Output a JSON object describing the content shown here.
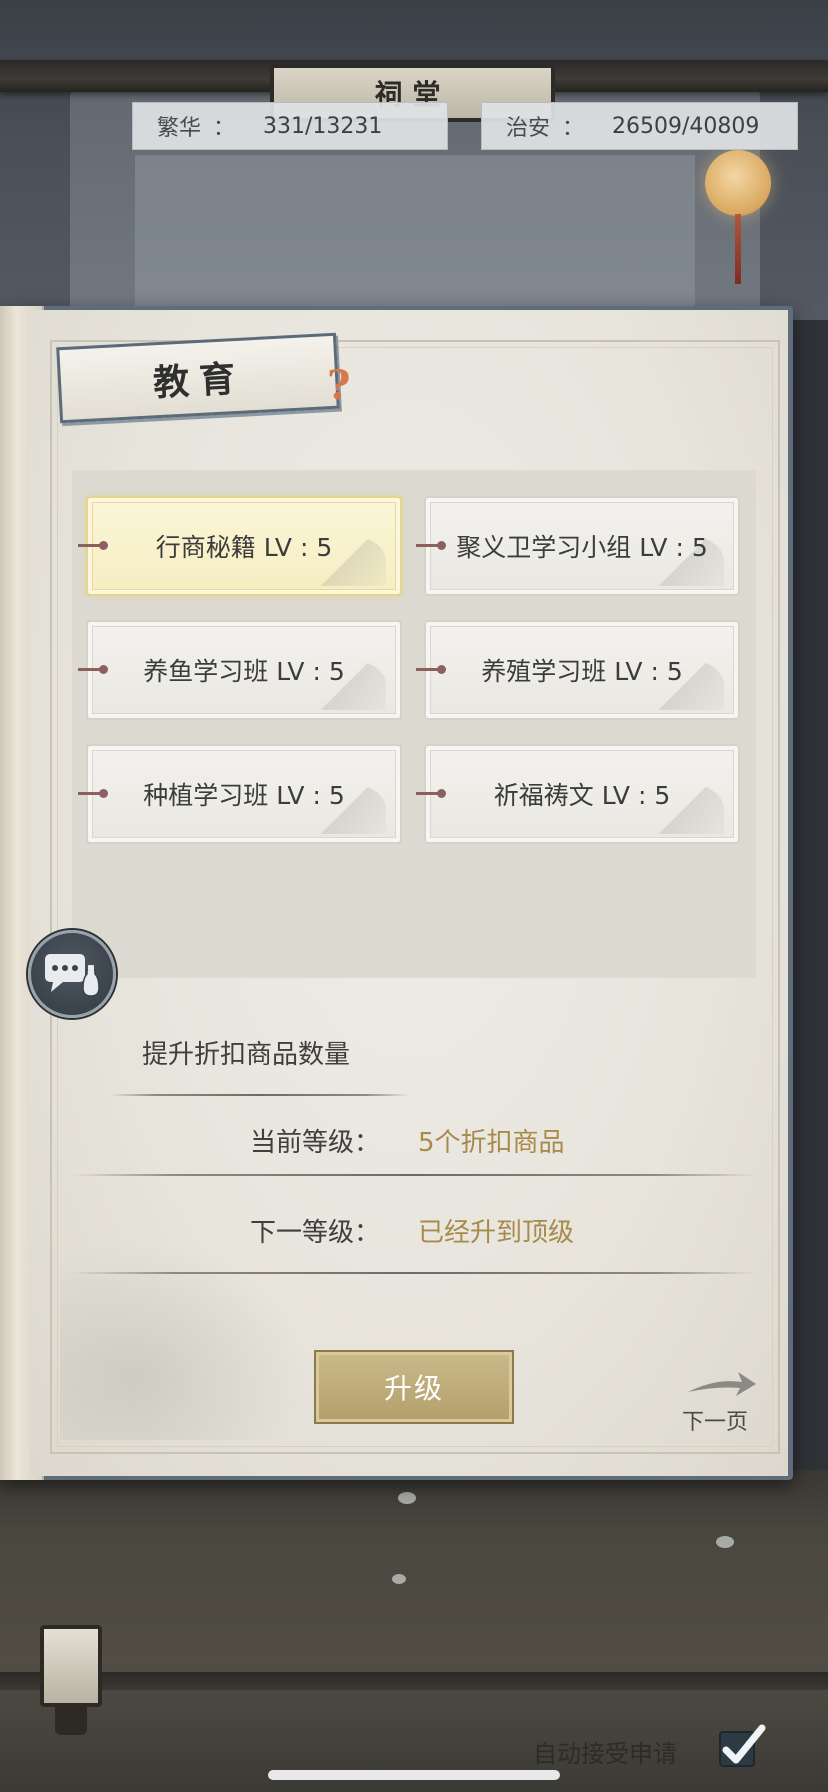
{
  "hall_sign": "祠堂",
  "stats": {
    "prosperity": {
      "label": "繁华",
      "colon": "：",
      "value": "331/13231"
    },
    "security": {
      "label": "治安",
      "colon": "：",
      "value": "26509/40809"
    }
  },
  "panel": {
    "title": "教育",
    "help_symbol": "?"
  },
  "courses": [
    {
      "label": "行商秘籍 LV : 5",
      "selected": true
    },
    {
      "label": "聚义卫学习小组 LV : 5",
      "selected": false
    },
    {
      "label": "养鱼学习班 LV : 5",
      "selected": false
    },
    {
      "label": "养殖学习班 LV : 5",
      "selected": false
    },
    {
      "label": "种植学习班 LV : 5",
      "selected": false
    },
    {
      "label": "祈福祷文 LV : 5",
      "selected": false
    }
  ],
  "detail": {
    "description": "提升折扣商品数量",
    "current_label": "当前等级：",
    "current_value": "5个折扣商品",
    "next_label": "下一等级：",
    "next_value": "已经升到顶级"
  },
  "buttons": {
    "upgrade": "升级",
    "next_page": "下一页"
  },
  "footer": {
    "auto_accept": "自动接受申请",
    "auto_accept_checked": true
  },
  "colors": {
    "accent_gold": "#a88b4a",
    "button_gold": "#b49f6b",
    "help_orange": "#d8784a",
    "selected_card": "#f6edc1"
  },
  "icons": {
    "chat": "chat-bubble-icon",
    "help": "question-mark-icon",
    "next": "arrow-right-icon",
    "check": "checkmark-icon"
  }
}
